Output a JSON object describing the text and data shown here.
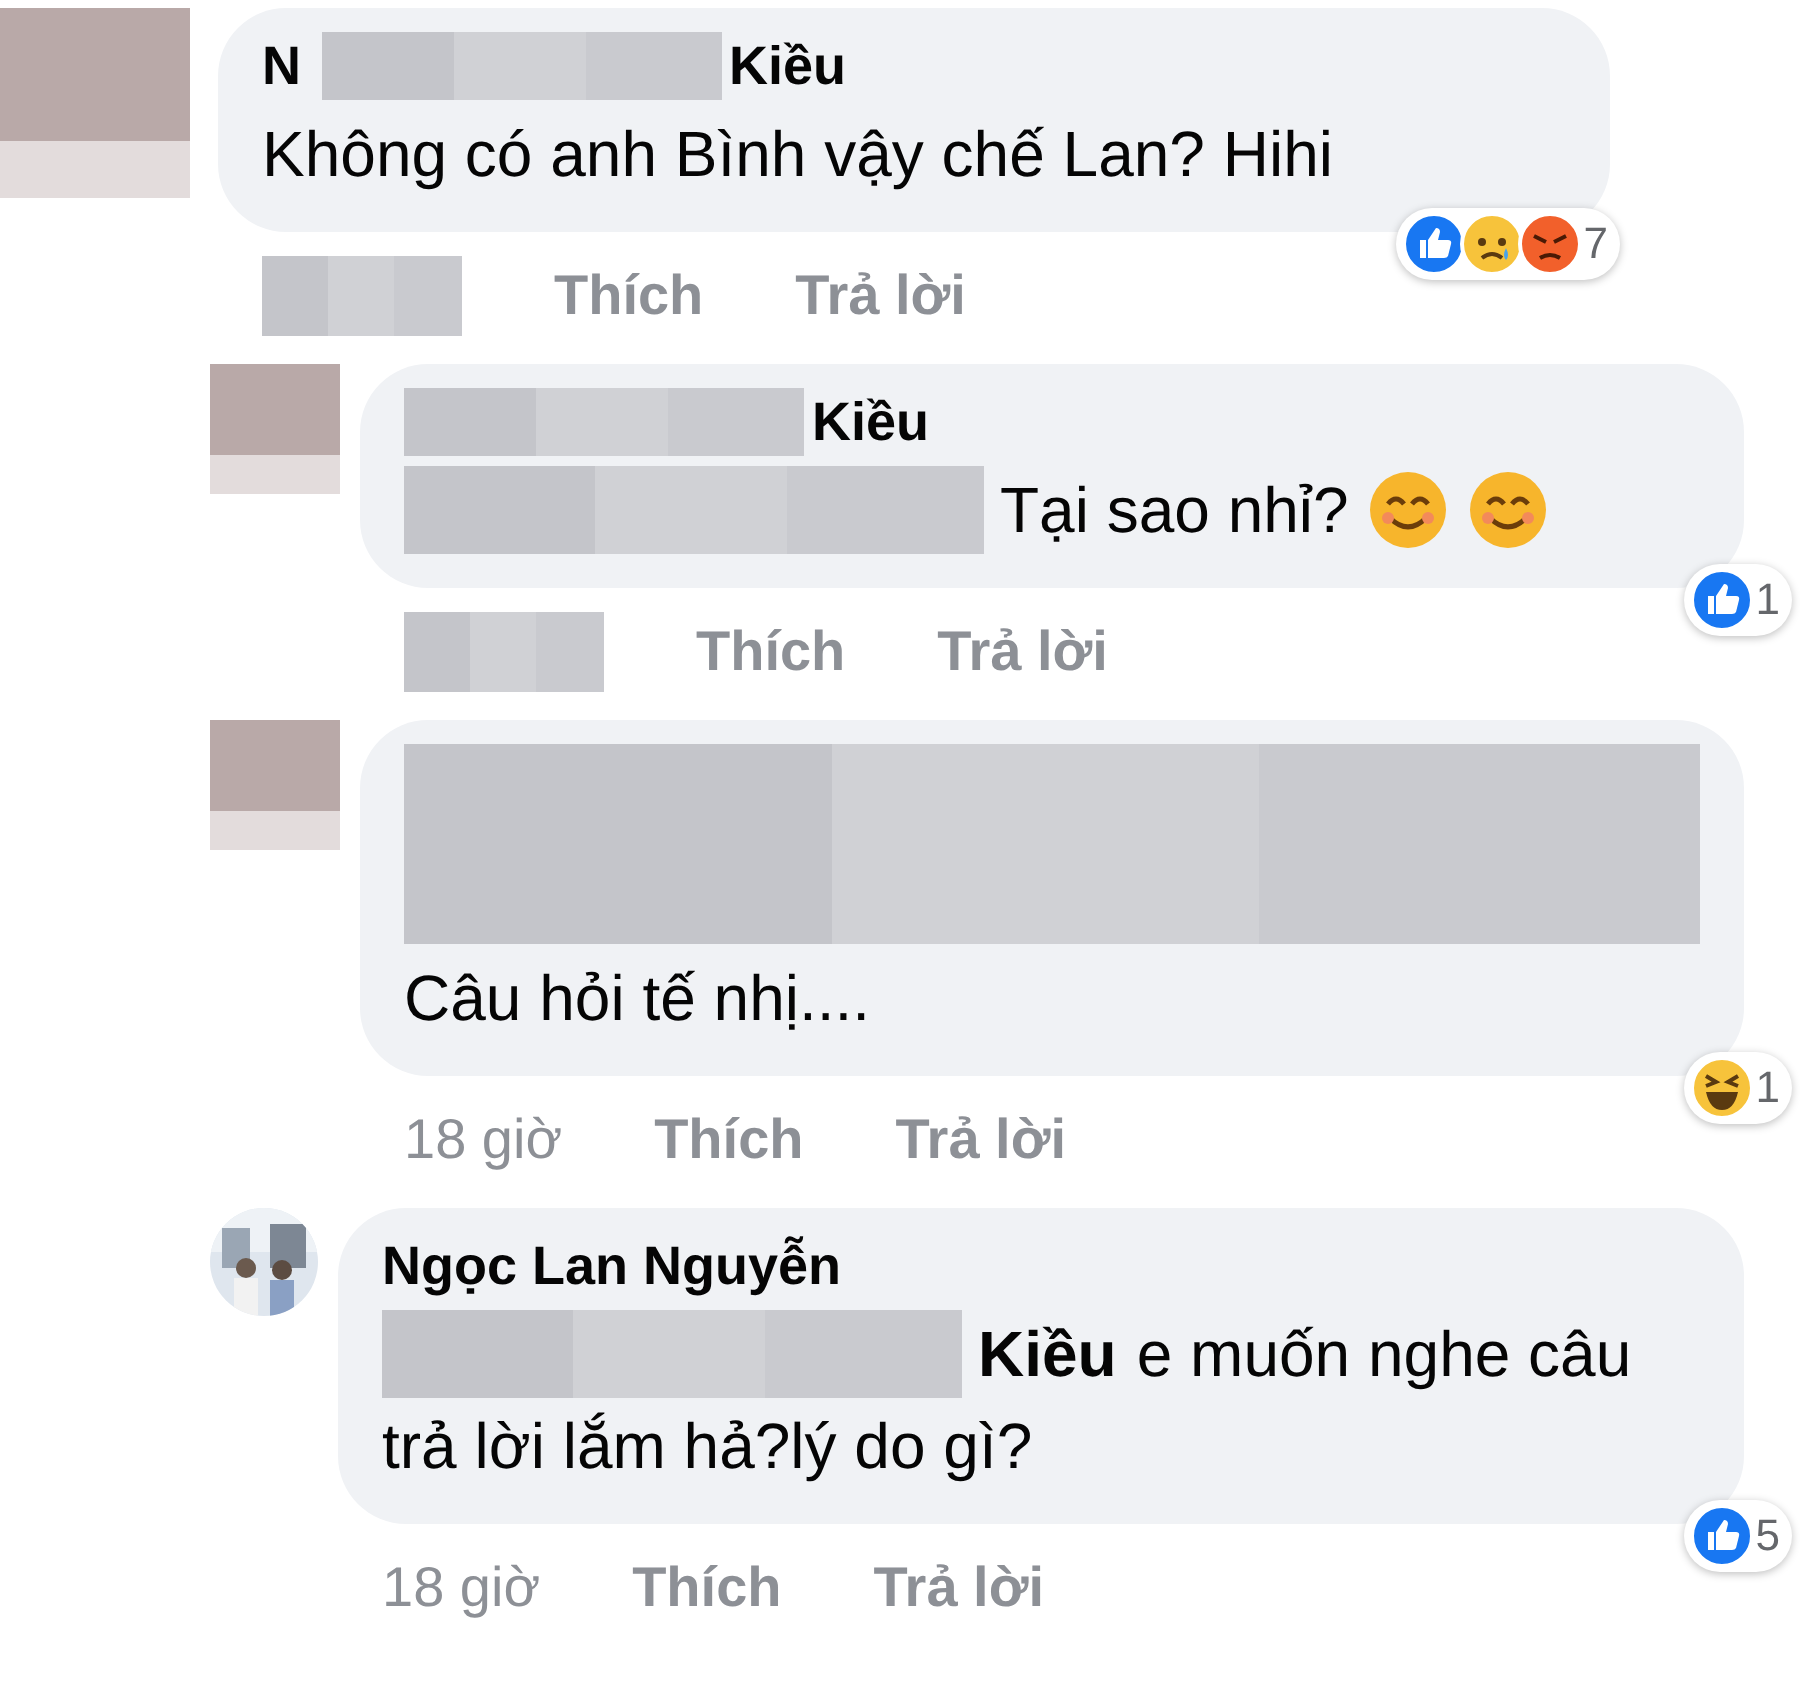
{
  "comments": [
    {
      "reply": false,
      "avatar": {
        "kind": "redacted"
      },
      "name": [
        {
          "kind": "text",
          "text": "N"
        },
        {
          "kind": "redacted"
        },
        {
          "kind": "text",
          "text": "Kiều"
        }
      ],
      "body": [
        {
          "kind": "text",
          "text": "Không có anh Bình vậy chế Lan? Hihi"
        }
      ],
      "meta": [
        {
          "kind": "redacted"
        },
        {
          "kind": "action",
          "text": "Thích"
        },
        {
          "kind": "action",
          "text": "Trả lời"
        }
      ],
      "reactions": {
        "icons": [
          {
            "kind": "like"
          },
          {
            "kind": "sad"
          },
          {
            "kind": "angry"
          }
        ],
        "count": "7"
      }
    },
    {
      "reply": true,
      "avatar": {
        "kind": "redacted"
      },
      "name": [
        {
          "kind": "redacted"
        },
        {
          "kind": "text",
          "text": "Kiều"
        }
      ],
      "body": [
        {
          "kind": "redacted"
        },
        {
          "kind": "text",
          "text": "Tại sao nhỉ?"
        },
        {
          "kind": "emoji"
        },
        {
          "kind": "emoji"
        }
      ],
      "meta": [
        {
          "kind": "redacted"
        },
        {
          "kind": "action",
          "text": "Thích"
        },
        {
          "kind": "action",
          "text": "Trả lời"
        }
      ],
      "reactions": {
        "icons": [
          {
            "kind": "like"
          }
        ],
        "count": "1"
      }
    },
    {
      "reply": true,
      "avatar": {
        "kind": "redacted"
      },
      "name": [
        {
          "kind": "redacted_block"
        }
      ],
      "body": [
        {
          "kind": "text",
          "text": "Câu hỏi tế nhị...."
        }
      ],
      "meta": [
        {
          "kind": "time",
          "text": "18 giờ"
        },
        {
          "kind": "action",
          "text": "Thích"
        },
        {
          "kind": "action",
          "text": "Trả lời"
        }
      ],
      "reactions": {
        "icons": [
          {
            "kind": "haha"
          }
        ],
        "count": "1"
      }
    },
    {
      "reply": true,
      "avatar": {
        "kind": "picture"
      },
      "name": [
        {
          "kind": "text",
          "text": "Ngọc Lan Nguyễn"
        }
      ],
      "body": [
        {
          "kind": "redacted"
        },
        {
          "kind": "mention",
          "text": "Kiều"
        },
        {
          "kind": "text",
          "text": "e muốn nghe câu"
        },
        {
          "kind": "text",
          "text": "trả lời lắm hả?lý do gì?"
        }
      ],
      "meta": [
        {
          "kind": "time",
          "text": "18 giờ"
        },
        {
          "kind": "action",
          "text": "Thích"
        },
        {
          "kind": "action",
          "text": "Trả lời"
        }
      ],
      "reactions": {
        "icons": [
          {
            "kind": "like"
          }
        ],
        "count": "5"
      }
    }
  ]
}
